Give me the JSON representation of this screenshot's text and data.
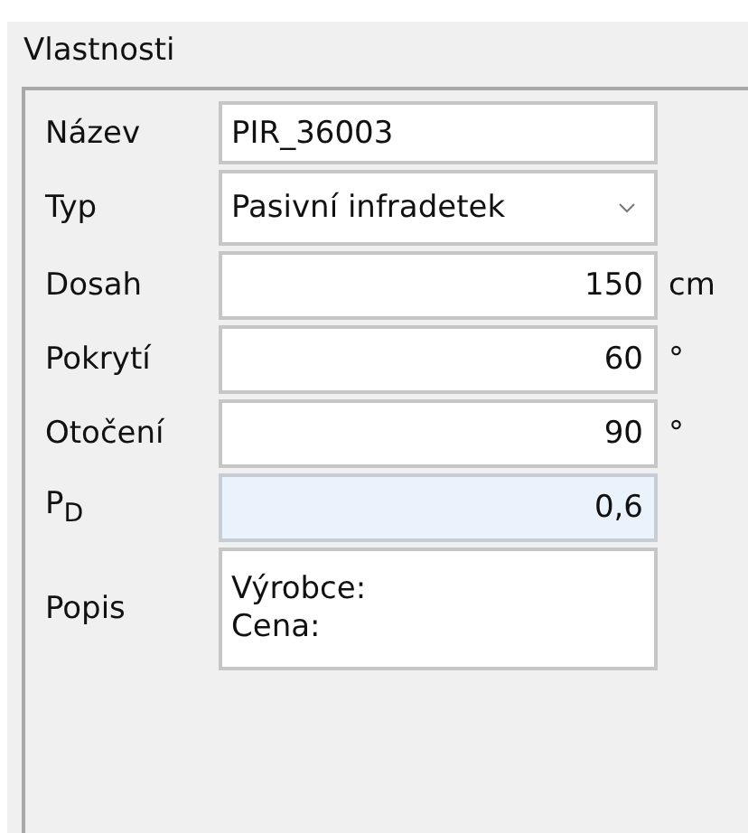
{
  "panel": {
    "title": "Vlastnosti"
  },
  "fields": [
    {
      "kind": "text",
      "label": "Název",
      "value": "PIR_36003",
      "highlighted": false
    },
    {
      "kind": "select",
      "label": "Typ",
      "value": "Pasivní infradetek",
      "highlighted": false
    },
    {
      "kind": "number",
      "label": "Dosah",
      "value": "150",
      "unit": "cm",
      "highlighted": false
    },
    {
      "kind": "number",
      "label": "Pokrytí",
      "value": "60",
      "unit": "°",
      "highlighted": false
    },
    {
      "kind": "number",
      "label": "Otočení",
      "value": "90",
      "unit": "°",
      "highlighted": false
    },
    {
      "kind": "number",
      "label": "P$_{D}$",
      "value": "0,6",
      "highlighted": true
    },
    {
      "kind": "multiline",
      "label": "Popis",
      "lines": [
        "Výrobce:",
        "Cena:"
      ],
      "highlighted": false
    }
  ]
}
